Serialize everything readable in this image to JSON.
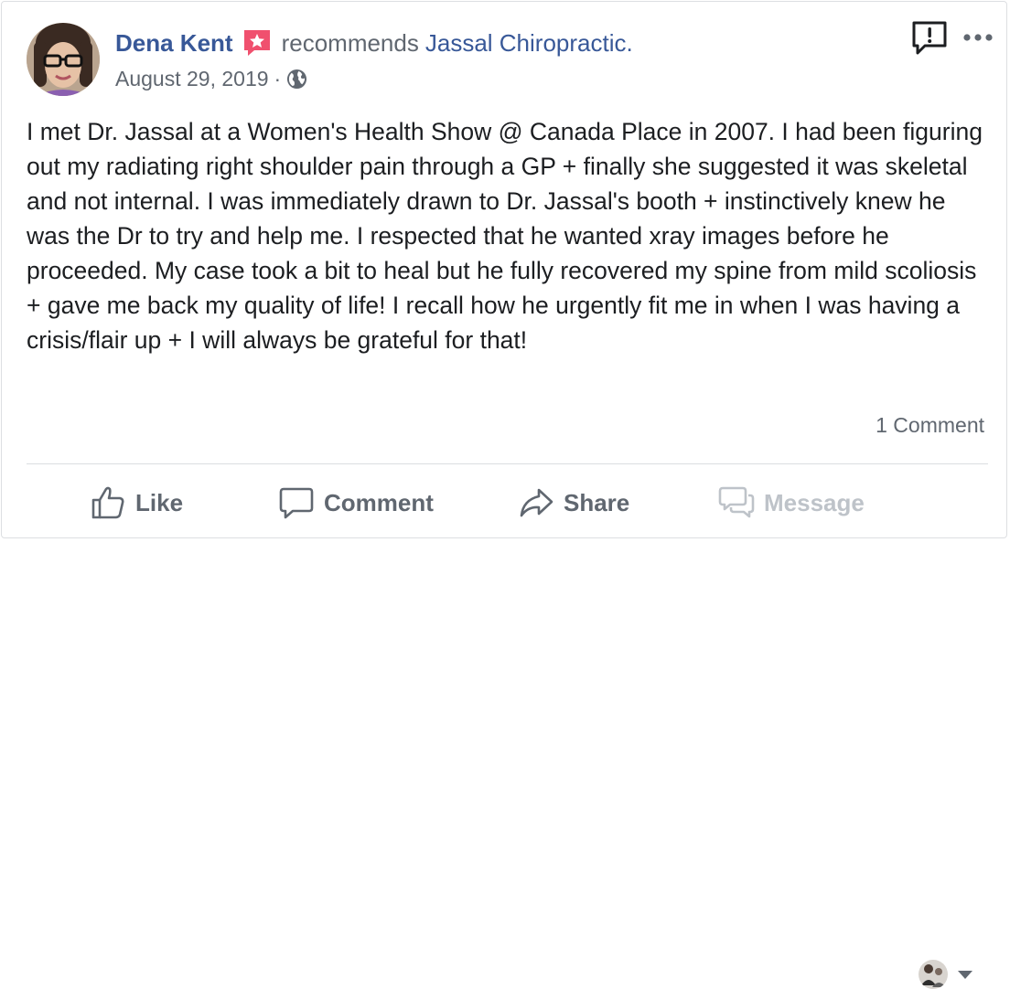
{
  "post": {
    "author": "Dena Kent",
    "author_badge_icon": "star-badge-icon",
    "verb": "recommends",
    "page_name": "Jassal Chiropractic.",
    "date": "August 29, 2019",
    "separator": "·",
    "privacy_icon": "globe-icon",
    "body": "I met Dr. Jassal at a Women's Health Show @ Canada Place in 2007. I had been figuring out my radiating right shoulder pain through a GP + finally she suggested it was skeletal and not internal. I was immediately drawn to Dr. Jassal's booth + instinctively knew he was the Dr to try and help me. I respected that he wanted xray images before he proceeded. My case took a bit to heal but he fully recovered my spine from mild scoliosis + gave me back my quality of life! I recall how he urgently fit me in when I was having a crisis/flair up + I will always be grateful for that!",
    "comment_count": "1 Comment"
  },
  "actions": {
    "like": "Like",
    "comment": "Comment",
    "share": "Share",
    "message": "Message"
  },
  "colors": {
    "link_blue": "#385898",
    "meta_gray": "#606770",
    "badge_red": "#f0506e",
    "disabled_gray": "#bec3c9"
  }
}
